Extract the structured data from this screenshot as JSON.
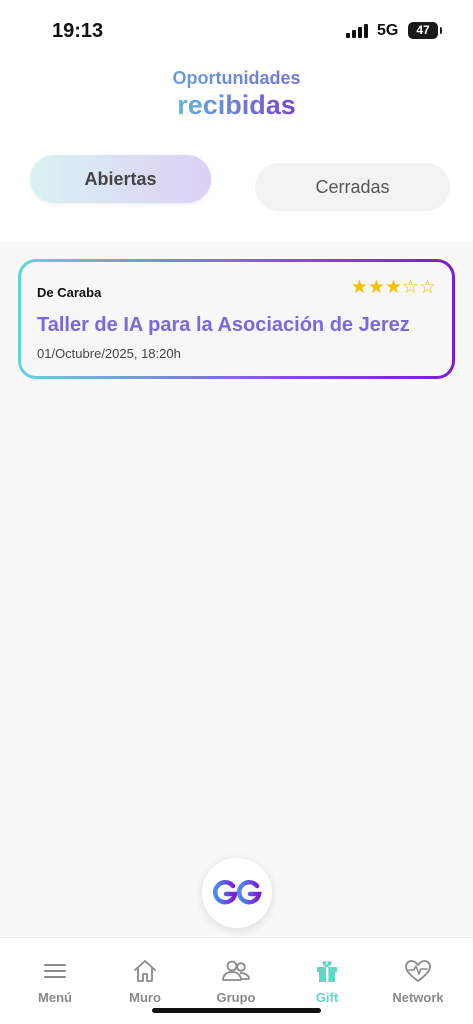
{
  "status_bar": {
    "time": "19:13",
    "network": "5G",
    "battery": "47"
  },
  "header": {
    "title_line1": "Oportunidades",
    "title_line2": "recibidas"
  },
  "tabs": {
    "open_label": "Abiertas",
    "closed_label": "Cerradas",
    "selected": "Abiertas"
  },
  "opportunities": [
    {
      "from": "De Caraba",
      "title": "Taller de IA para la Asociación de Jerez",
      "date": "01/Octubre/2025, 18:20h",
      "rating": 3,
      "rating_max": 5,
      "stars_text": "★★★☆☆"
    }
  ],
  "logo": {
    "icon": "go-logo-icon"
  },
  "bottom_nav": {
    "items": [
      {
        "label": "Menú",
        "icon": "menu-icon"
      },
      {
        "label": "Muro",
        "icon": "home-icon"
      },
      {
        "label": "Grupo",
        "icon": "group-icon"
      },
      {
        "label": "Gift",
        "icon": "gift-icon"
      },
      {
        "label": "Network",
        "icon": "heartbeat-icon"
      }
    ],
    "active": "Gift"
  },
  "colors": {
    "accent_teal": "#5fd8d5",
    "accent_purple": "#7a24d6",
    "card_title": "#7a68de",
    "star": "#f2c200",
    "nav_inactive": "#8a8a8a",
    "nav_active": "#5fd8c8"
  }
}
